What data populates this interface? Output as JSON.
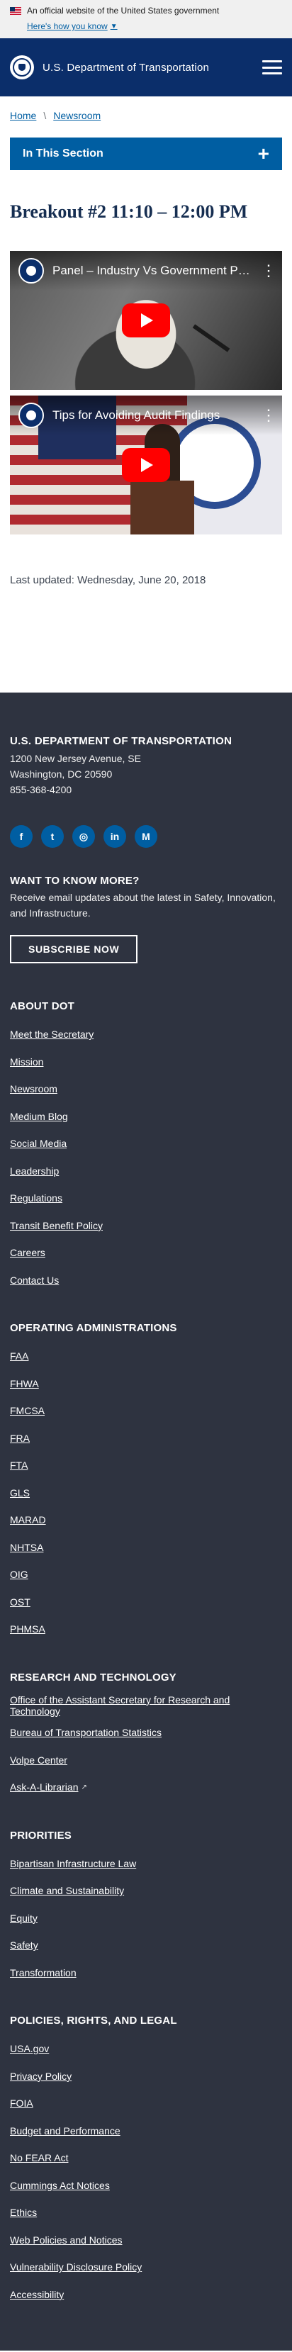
{
  "gov_banner": {
    "text": "An official website of the United States government",
    "link": "Here's how you know"
  },
  "header": {
    "site_name": "U.S. Department of Transportation"
  },
  "breadcrumb": [
    "Home",
    "Newsroom"
  ],
  "section_toggle": {
    "label": "In This Section"
  },
  "page_title": "Breakout #2 11:10 – 12:00 PM",
  "videos": [
    {
      "title": "Panel – Industry Vs Government Perspectives"
    },
    {
      "title": "Tips for Avoiding Audit Findings"
    }
  ],
  "last_updated": "Last updated: Wednesday, June 20, 2018",
  "footer": {
    "agency": "U.S. DEPARTMENT OF TRANSPORTATION",
    "address_1": "1200 New Jersey Avenue, SE",
    "address_2": "Washington, DC 20590",
    "phone": "855-368-4200",
    "socials": [
      {
        "icon": "facebook-icon",
        "glyph": "f"
      },
      {
        "icon": "twitter-icon",
        "glyph": "t"
      },
      {
        "icon": "instagram-icon",
        "glyph": "◎"
      },
      {
        "icon": "linkedin-icon",
        "glyph": "in"
      },
      {
        "icon": "medium-icon",
        "glyph": "M"
      }
    ],
    "want_to_know": {
      "heading": "WANT TO KNOW MORE?",
      "text": "Receive email updates about the latest in Safety, Innovation, and Infrastructure.",
      "button": "SUBSCRIBE NOW"
    },
    "sections": [
      {
        "heading": "ABOUT DOT",
        "links": [
          "Meet the Secretary",
          "Mission",
          "Newsroom",
          "Medium Blog",
          "Social Media",
          "Leadership",
          "Regulations",
          "Transit Benefit Policy",
          "Careers",
          "Contact Us"
        ]
      },
      {
        "heading": "OPERATING ADMINISTRATIONS",
        "links": [
          "FAA",
          "FHWA",
          "FMCSA",
          "FRA",
          "FTA",
          "GLS",
          "MARAD",
          "NHTSA",
          "OIG",
          "OST",
          "PHMSA"
        ]
      },
      {
        "heading": "RESEARCH AND TECHNOLOGY",
        "links": [
          "Office of the Assistant Secretary for Research and Technology",
          "Bureau of Transportation Statistics",
          "Volpe Center",
          "Ask-A-Librarian"
        ]
      },
      {
        "heading": "PRIORITIES",
        "links": [
          "Bipartisan Infrastructure Law",
          "Climate and Sustainability",
          "Equity",
          "Safety",
          "Transformation"
        ]
      },
      {
        "heading": "POLICIES, RIGHTS, AND LEGAL",
        "links": [
          "USA.gov",
          "Privacy Policy",
          "FOIA",
          "Budget and Performance",
          "No FEAR Act",
          "Cummings Act Notices",
          "Ethics",
          "Web Policies and Notices",
          "Vulnerability Disclosure Policy",
          "Accessibility"
        ]
      }
    ]
  },
  "colors": {
    "header_bg": "#0b2e6a",
    "accent": "#005ea2",
    "title": "#162e51",
    "footer_bg": "#2e3340"
  }
}
